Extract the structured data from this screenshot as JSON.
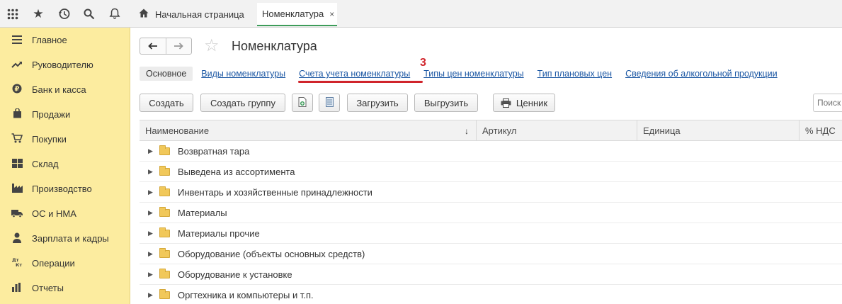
{
  "topbar": {
    "icons": [
      "grid-icon",
      "star-icon",
      "history-icon",
      "search-icon",
      "bell-icon"
    ],
    "tabs": [
      {
        "label": "Начальная страница",
        "icon": "home-icon"
      },
      {
        "label": "Номенклатура",
        "close": "×"
      }
    ]
  },
  "sidebar": {
    "items": [
      {
        "label": "Главное",
        "icon": "menu-icon"
      },
      {
        "label": "Руководителю",
        "icon": "trend-icon"
      },
      {
        "label": "Банк и касса",
        "icon": "ruble-icon"
      },
      {
        "label": "Продажи",
        "icon": "bag-icon"
      },
      {
        "label": "Покупки",
        "icon": "cart-icon"
      },
      {
        "label": "Склад",
        "icon": "warehouse-icon"
      },
      {
        "label": "Производство",
        "icon": "factory-icon"
      },
      {
        "label": "ОС и НМА",
        "icon": "truck-icon"
      },
      {
        "label": "Зарплата и кадры",
        "icon": "person-icon"
      },
      {
        "label": "Операции",
        "icon": "dt-kt-icon"
      },
      {
        "label": "Отчеты",
        "icon": "chart-icon"
      }
    ]
  },
  "main": {
    "title": "Номенклатура",
    "sections": [
      {
        "label": "Основное",
        "active": true
      },
      {
        "label": "Виды номенклатуры"
      },
      {
        "label": "Счета учета номенклатуры"
      },
      {
        "label": "Типы цен номенклатуры"
      },
      {
        "label": "Тип плановых цен"
      },
      {
        "label": "Сведения об алкогольной продукции"
      }
    ],
    "annotation": "3",
    "commands": {
      "create": "Создать",
      "create_group": "Создать группу",
      "load": "Загрузить",
      "unload": "Выгрузить",
      "price_tag": "Ценник"
    },
    "search_placeholder": "Поиск",
    "table": {
      "columns": [
        "Наименование",
        "Артикул",
        "Единица",
        "% НДС"
      ],
      "rows": [
        "Возвратная тара",
        "Выведена из ассортимента",
        "Инвентарь и хозяйственные принадлежности",
        "Материалы",
        "Материалы прочие",
        "Оборудование (объекты основных средств)",
        "Оборудование к установке",
        "Оргтехника и компьютеры и т.п."
      ]
    }
  },
  "colors": {
    "sidebar_bg": "#fcec9f",
    "link": "#1a56a3",
    "annotation": "#d0242b",
    "active_tab_underline": "#3d9c5a",
    "folder": "#f1c85a"
  }
}
